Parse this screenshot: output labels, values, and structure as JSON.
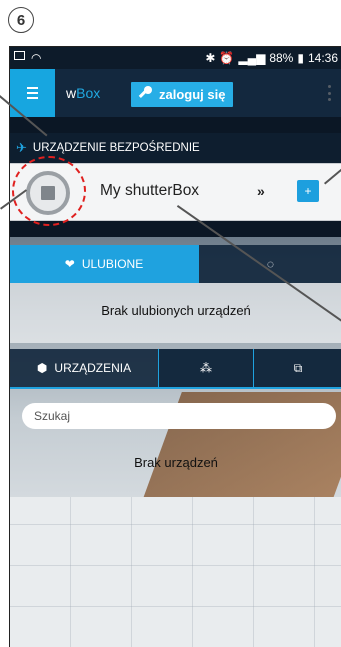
{
  "step_badge": "6",
  "status_bar": {
    "left_icons": [
      "image-icon",
      "wifi-icon"
    ],
    "right_icons": [
      "bluetooth-icon",
      "alarm-icon",
      "wifi-icon",
      "signal-icon"
    ],
    "battery": "88%",
    "time": "14:36"
  },
  "app_bar": {
    "brand_w": "w",
    "brand_box": "Box",
    "login_label": "zaloguj się"
  },
  "direct_section": {
    "title": "URZĄDZENIE BEZPOŚREDNIE"
  },
  "device": {
    "name": "My shutterBox",
    "arrow": "»",
    "add_label": "+"
  },
  "favorites": {
    "tab_label": "ULUBIONE",
    "empty_text": "Brak ulubionych urządzeń"
  },
  "devices": {
    "tab_label": "URZĄDZENIA",
    "empty_text": "Brak urządzeń"
  },
  "search": {
    "placeholder": "Szukaj",
    "value": ""
  },
  "colors": {
    "accent": "#1fa2df",
    "highlight": "#e0201f",
    "app_bar": "#13283e"
  }
}
